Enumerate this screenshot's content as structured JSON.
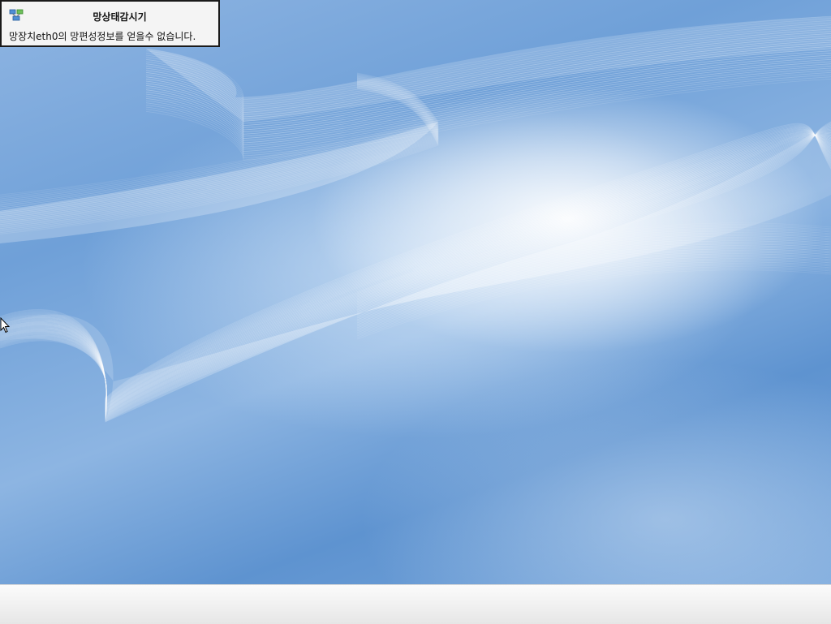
{
  "notification": {
    "icon": "network-status-icon",
    "title": "망상태감시기",
    "message": "망장치eth0의 망편성정보를 얻을수 없습니다."
  },
  "desktop": {
    "wallpaper": "blue-light-waves",
    "colors": {
      "base": "#6fa0d8",
      "highlight": "#ffffff",
      "taskbar": "#f1f1f1"
    }
  },
  "cursor": {
    "icon": "arrow-pointer-icon"
  }
}
